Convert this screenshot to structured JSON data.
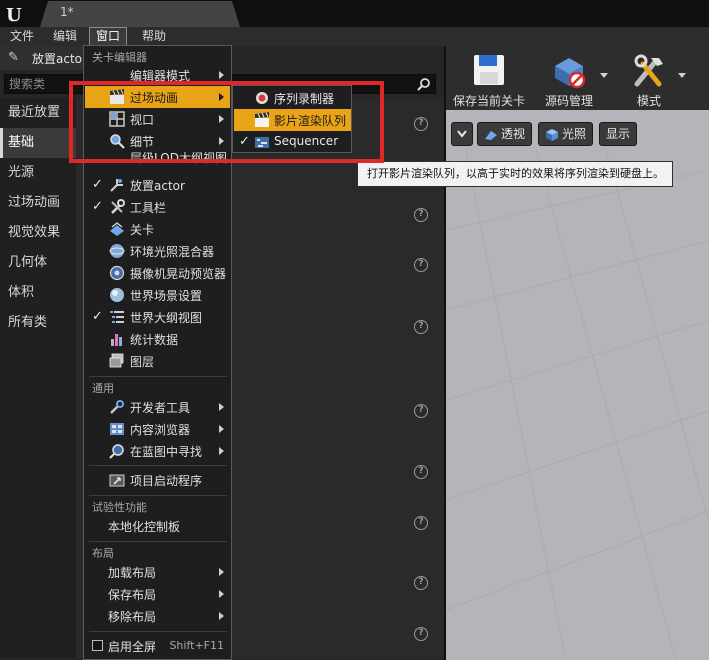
{
  "app": {
    "tab_title": "1*"
  },
  "menubar": {
    "items": [
      {
        "label": "文件",
        "name": "file"
      },
      {
        "label": "编辑",
        "name": "edit"
      },
      {
        "label": "窗口",
        "name": "window"
      },
      {
        "label": "帮助",
        "name": "help"
      }
    ]
  },
  "left_panel": {
    "tab_label": "放置actor",
    "search_placeholder": "搜索类",
    "categories": [
      "最近放置",
      "基础",
      "光源",
      "过场动画",
      "视觉效果",
      "几何体",
      "体积",
      "所有类"
    ],
    "selected_category": "基础"
  },
  "toolbar": {
    "buttons": [
      {
        "label": "保存当前关卡",
        "icon": "save-disk-icon"
      },
      {
        "label": "源码管理",
        "icon": "source-control-icon"
      },
      {
        "label": "模式",
        "icon": "modes-tools-icon"
      }
    ]
  },
  "viewport": {
    "buttons": [
      {
        "label": "透视",
        "icon": "perspective-icon"
      },
      {
        "label": "光照",
        "icon": "lit-cube-icon"
      },
      {
        "label": "显示",
        "icon": ""
      }
    ]
  },
  "window_menu": {
    "section_level_editor": "关卡编辑器",
    "section_general": "通用",
    "section_experimental": "试验性功能",
    "section_layout": "布局",
    "partial_editor_modes": "编辑器模式",
    "cinematics": "过场动画",
    "viewports": "视口",
    "details": "细节",
    "partial_hlod": "层级LOD大纲视图",
    "place_actors": "放置actor",
    "toolbar": "工具栏",
    "levels": "关卡",
    "env_light_mixer": "环境光照混合器",
    "camera_shake_previewer": "摄像机晃动预览器",
    "world_settings": "世界场景设置",
    "world_outliner": "世界大纲视图",
    "statistics": "统计数据",
    "layers": "图层",
    "developer_tools": "开发者工具",
    "content_browser": "内容浏览器",
    "find_in_blueprints": "在蓝图中寻找",
    "project_launcher": "项目启动程序",
    "localization_dashboard": "本地化控制板",
    "load_layout": "加载布局",
    "save_layout": "保存布局",
    "remove_layout": "移除布局",
    "fullscreen": "启用全屏",
    "fullscreen_shortcut": "Shift+F11"
  },
  "cinematics_submenu": {
    "items": [
      {
        "label": "序列录制器",
        "icon": "record-icon"
      },
      {
        "label": "影片渲染队列",
        "icon": "clapperboard-icon"
      },
      {
        "label": "Sequencer",
        "icon": "sequencer-icon"
      }
    ],
    "highlighted": "影片渲染队列",
    "checked": "Sequencer"
  },
  "tooltip": {
    "text": "打开影片渲染队列，以高于实时的效果将序列渲染到硬盘上。"
  },
  "colors": {
    "highlight": "#e8a317",
    "annotation_red": "#e02828",
    "viewport_floor": "#b4b4bb"
  }
}
